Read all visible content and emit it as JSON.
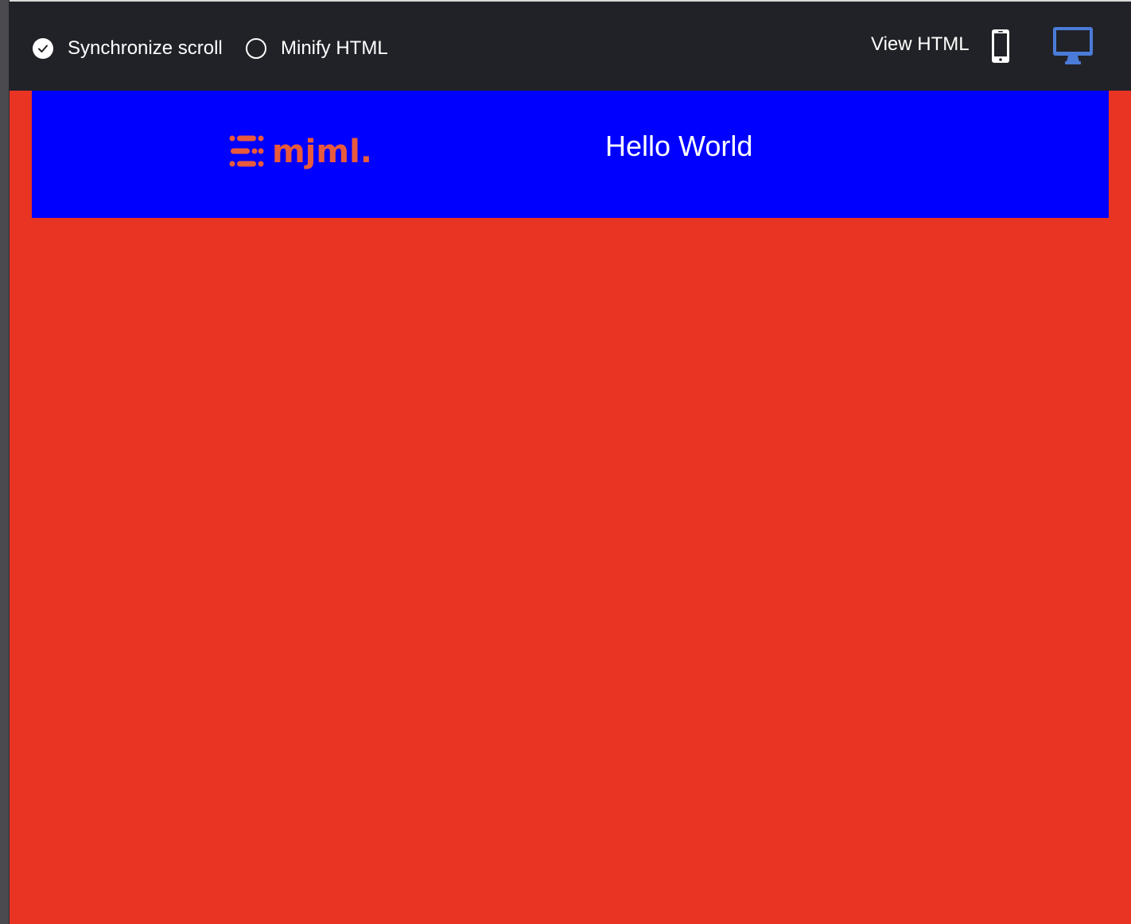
{
  "toolbar": {
    "sync_label": "Synchronize scroll",
    "sync_checked": true,
    "minify_label": "Minify HTML",
    "minify_checked": false,
    "view_html_label": "View HTML",
    "mobile_icon": "mobile-phone-icon",
    "desktop_icon": "desktop-monitor-icon",
    "active_view": "desktop"
  },
  "preview": {
    "logo_text": "mjml.",
    "heading": "Hello World"
  },
  "colors": {
    "toolbar_bg": "#212227",
    "page_bg": "#e93323",
    "section_bg": "#0000ff",
    "logo_color": "#e85a3c",
    "active_icon": "#4b7bd8",
    "text": "#ffffff"
  }
}
